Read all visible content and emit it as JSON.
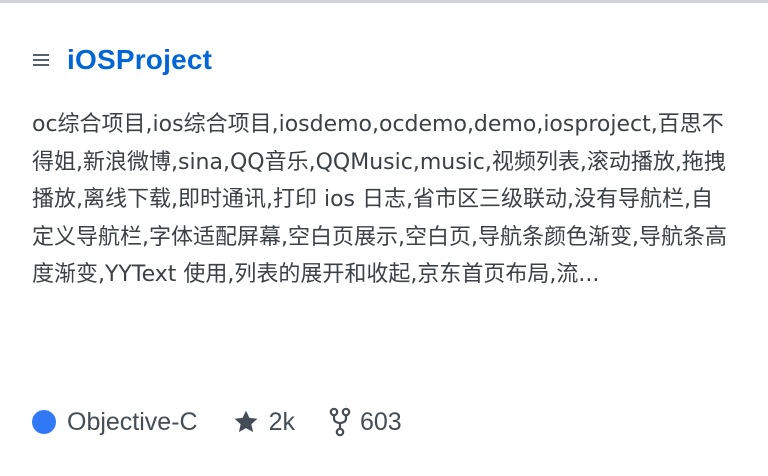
{
  "repo": {
    "name": "iOSProject",
    "description": "oc综合项目,ios综合项目,iosdemo,ocdemo,demo,iosproject,百思不得姐,新浪微博,sina,QQ音乐,QQMusic,music,视频列表,滚动播放,拖拽播放,离线下载,即时通讯,打印 ios 日志,省市区三级联动,没有导航栏,自定义导航栏,字体适配屏幕,空白页展示,空白页,导航条颜色渐变,导航条高度渐变,YYText 使用,列表的展开和收起,京东首页布局,流...",
    "language": "Objective-C",
    "language_color": "#3178f6",
    "stars": "2k",
    "forks": "603"
  },
  "icons": {
    "list": "list-icon",
    "star": "star-icon",
    "fork": "fork-icon"
  },
  "colors": {
    "link": "#0366d6",
    "icon": "#586069"
  }
}
